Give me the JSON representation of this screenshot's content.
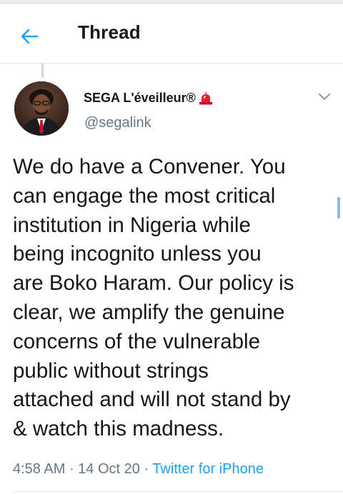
{
  "header": {
    "back_icon": "arrow-left-icon",
    "title": "Thread"
  },
  "tweet": {
    "author": {
      "display_name": "SEGA L'éveilleur®",
      "badge_icon": "siren-icon",
      "handle": "@segalink"
    },
    "menu_icon": "chevron-down-icon",
    "text": "We do have a Convener. You\ncan engage the most critical\ninstitution in Nigeria while\nbeing incognito unless you\nare Boko Haram. Our policy is\nclear, we amplify the genuine\nconcerns of the vulnerable\npublic without strings\nattached and will not stand by\n& watch this madness.",
    "time": "4:58 AM",
    "separator1": " · ",
    "date": "14 Oct 20",
    "separator2": " · ",
    "source": "Twitter for iPhone"
  },
  "colors": {
    "accent": "#1da1f2",
    "secondary_text": "#657786",
    "primary_text": "#14171a",
    "divider": "#e1e8ed"
  }
}
